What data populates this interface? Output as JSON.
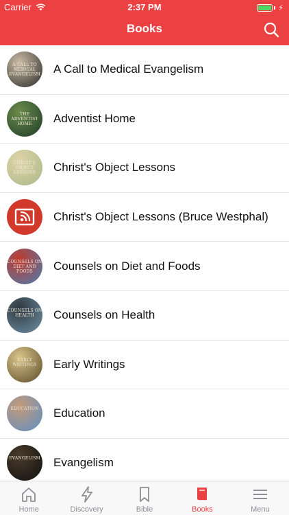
{
  "status_bar": {
    "carrier": "Carrier",
    "time": "2:37 PM"
  },
  "header": {
    "title": "Books"
  },
  "books": [
    {
      "title": "A Call to Medical Evangelism",
      "cover_text": "A CALL TO MEDICAL EVANGELISM",
      "cover_colors": [
        "#2b2b2b",
        "#c9bba3"
      ]
    },
    {
      "title": "Adventist Home",
      "cover_text": "THE ADVENTIST HOME",
      "cover_colors": [
        "#1f3b2a",
        "#6a8b4a"
      ]
    },
    {
      "title": "Christ's Object Lessons",
      "cover_text": "CHRIST'S OBJECT LESSONS",
      "cover_colors": [
        "#a9b88a",
        "#e0d4a8"
      ]
    },
    {
      "title": "Christ's Object Lessons (Bruce Westphal)",
      "cover_text": "",
      "cover_colors": [
        "#d13a2a",
        "#d13a2a"
      ]
    },
    {
      "title": "Counsels on Diet and Foods",
      "cover_text": "COUNSELS ON DIET AND FOODS",
      "cover_colors": [
        "#4a7fb3",
        "#c0392b"
      ]
    },
    {
      "title": "Counsels on Health",
      "cover_text": "COUNSELS ON HEALTH",
      "cover_colors": [
        "#6f8fa5",
        "#2f3a40"
      ]
    },
    {
      "title": "Early Writings",
      "cover_text": "EARLY WRITINGS",
      "cover_colors": [
        "#5c4b2a",
        "#d8c48a"
      ]
    },
    {
      "title": "Education",
      "cover_text": "EDUCATION",
      "cover_colors": [
        "#5d8fc4",
        "#c49a7a"
      ]
    },
    {
      "title": "Evangelism",
      "cover_text": "EVANGELISM",
      "cover_colors": [
        "#111111",
        "#4a3a2a"
      ]
    }
  ],
  "tabs": [
    {
      "label": "Home",
      "icon": "home-icon",
      "active": false
    },
    {
      "label": "Discovery",
      "icon": "lightning-icon",
      "active": false
    },
    {
      "label": "Bible",
      "icon": "bookmark-icon",
      "active": false
    },
    {
      "label": "Books",
      "icon": "book-icon",
      "active": true
    },
    {
      "label": "Menu",
      "icon": "menu-icon",
      "active": false
    }
  ],
  "colors": {
    "accent": "#ec4142",
    "battery": "#4cd964",
    "tab_inactive": "#8e8e93"
  }
}
